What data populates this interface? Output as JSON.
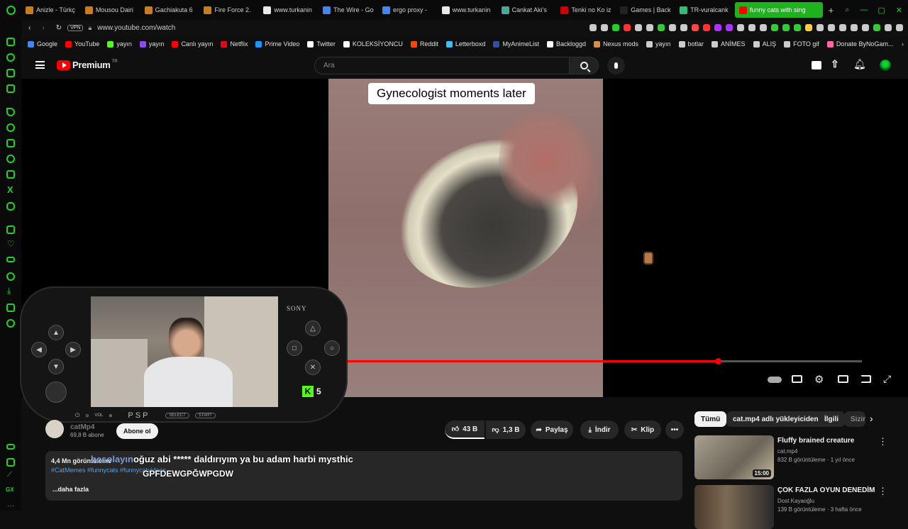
{
  "browser": {
    "tabs": [
      {
        "label": "Anizle - Türkç",
        "color": "#c97c1a"
      },
      {
        "label": "Mousou Dairi",
        "color": "#c97c1a"
      },
      {
        "label": "Gachiakuta 6",
        "color": "#c97c1a"
      },
      {
        "label": "Fire Force 2.",
        "color": "#c97c1a"
      },
      {
        "label": "www.turkanin",
        "color": "#e8e8e8"
      },
      {
        "label": "The Wire - Go",
        "color": "#4285f4"
      },
      {
        "label": "ergo proxy -",
        "color": "#4285f4"
      },
      {
        "label": "www.turkanin",
        "color": "#e8e8e8"
      },
      {
        "label": "Cankat Aki's",
        "color": "#4a9"
      },
      {
        "label": "Tenki no Ko iz",
        "color": "#c00"
      },
      {
        "label": "Games | Back",
        "color": "#222"
      },
      {
        "label": "TR-vuralcank",
        "color": "#3b7"
      },
      {
        "label": "funny cats with sing",
        "color": "#f00"
      }
    ],
    "url": "www.youtube.com/watch",
    "vpn_label": "VPN",
    "bookmarks": [
      {
        "label": "Google",
        "color": "#4285f4"
      },
      {
        "label": "YouTube",
        "color": "#f00"
      },
      {
        "label": "yayın",
        "color": "#53fc18"
      },
      {
        "label": "yayın",
        "color": "#9146ff"
      },
      {
        "label": "Canlı yayın",
        "color": "#f00"
      },
      {
        "label": "Netflix",
        "color": "#e50914"
      },
      {
        "label": "Prime Video",
        "color": "#1a98ff"
      },
      {
        "label": "Twitter",
        "color": "#fff"
      },
      {
        "label": "KOLEKSİYONCU",
        "color": "#fff"
      },
      {
        "label": "Reddit",
        "color": "#ff4500"
      },
      {
        "label": "Letterboxd",
        "color": "#40bcf4"
      },
      {
        "label": "MyAnimeList",
        "color": "#2e51a2"
      },
      {
        "label": "Backloggd",
        "color": "#fff"
      },
      {
        "label": "Nexus mods",
        "color": "#d98f40"
      },
      {
        "label": "yayın",
        "color": "#ccc"
      },
      {
        "label": "botlar",
        "color": "#ccc"
      },
      {
        "label": "ANİMES",
        "color": "#ccc"
      },
      {
        "label": "ALIŞ",
        "color": "#ccc"
      },
      {
        "label": "FOTO gif",
        "color": "#ccc"
      },
      {
        "label": "Donate ByNoGam...",
        "color": "#f6a"
      }
    ]
  },
  "youtube": {
    "logo_text": "Premium",
    "logo_sup": "TR",
    "search_placeholder": "Ara",
    "video_caption": "Gynecologist moments later",
    "progress": 0.72,
    "channel_name": "catMp4",
    "subscribers": "69,8 B abone",
    "subscribe_label": "Abone ol",
    "likes": "43 B",
    "dislikes": "1,3 B",
    "share_label": "Paylaş",
    "download_label": "İndir",
    "clip_label": "Klip",
    "views_line": "4,4 Mn görüntüleme",
    "hashtags": "#CatMemes #funnycats #funnycatvideos",
    "more_label": "...daha fazla",
    "chat_user": "besolayın",
    "chat_message": "oğuz abi ***** daldırıyım ya bu adam harbi mysthic",
    "chat_message2": "GPFDEWGPĞWPGDW",
    "kick_count": "5",
    "chips": [
      "Tümü",
      "cat.mp4 adlı yükleyiciden",
      "İlgili",
      "Sizin"
    ],
    "recommendations": [
      {
        "title": "Fluffy brained creature",
        "channel": "cat.mp4",
        "meta": "832 B görüntüleme · 1 yıl önce",
        "duration": "15:00"
      },
      {
        "title": "ÇOK FAZLA OYUN DENEDİM",
        "channel": "Dost Kayaoğlu",
        "meta": "139 B görüntüleme · 3 hafta önce",
        "duration": ""
      }
    ]
  },
  "psp": {
    "brand": "SONY",
    "logo": "PSP",
    "vol": "VOL",
    "select": "SELECT",
    "start": "START"
  }
}
